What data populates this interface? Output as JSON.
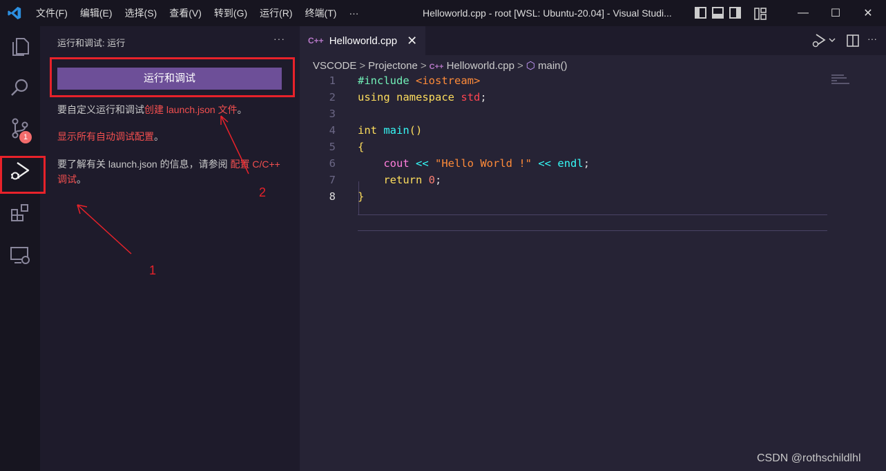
{
  "menu": [
    "文件(F)",
    "编辑(E)",
    "选择(S)",
    "查看(V)",
    "转到(G)",
    "运行(R)",
    "终端(T)",
    "···"
  ],
  "window_title": "Helloworld.cpp - root [WSL: Ubuntu-20.04] - Visual Studi...",
  "window_controls": {
    "minimize": "—",
    "maximize": "☐",
    "close": "✕"
  },
  "activity": {
    "scm_badge": "1"
  },
  "sidebar": {
    "title": "运行和调试: 运行",
    "more": "···",
    "run_button": "运行和调试",
    "text1_prefix": "要自定义运行和调试",
    "text1_link": "创建 launch.json 文件",
    "text1_suffix": "。",
    "link2": "显示所有自动调试配置",
    "link2_suffix": "。",
    "text3_prefix": "要了解有关 launch.json 的信息，请参阅 ",
    "text3_link": "配置 C/C++ 调试",
    "text3_suffix": "。"
  },
  "editor": {
    "tab_icon": "C++",
    "tab_label": "Helloworld.cpp",
    "tab_close": "✕",
    "breadcrumb": [
      "VSCODE",
      "Projectone",
      "Helloworld.cpp",
      "main()"
    ],
    "breadcrumb_sep": ">",
    "line_numbers": [
      "1",
      "2",
      "3",
      "4",
      "5",
      "6",
      "7",
      "8"
    ]
  },
  "code": {
    "l1_kw": "#include",
    "l1_arg": "<iostream>",
    "l2_a": "using",
    "l2_b": "namespace",
    "l2_c": "std",
    "l2_d": ";",
    "l4_a": "int",
    "l4_b": "main",
    "l4_c": "()",
    "l5": "{",
    "l6_a": "cout",
    "l6_b": "<<",
    "l6_c": "\"Hello World !\"",
    "l6_d": "<<",
    "l6_e": "endl",
    "l6_f": ";",
    "l7_a": "return",
    "l7_b": "0",
    "l7_c": ";",
    "l8": "}"
  },
  "annotations": {
    "n1": "1",
    "n2": "2",
    "color": "#e8222a"
  },
  "watermark": "CSDN @rothschildlhl"
}
